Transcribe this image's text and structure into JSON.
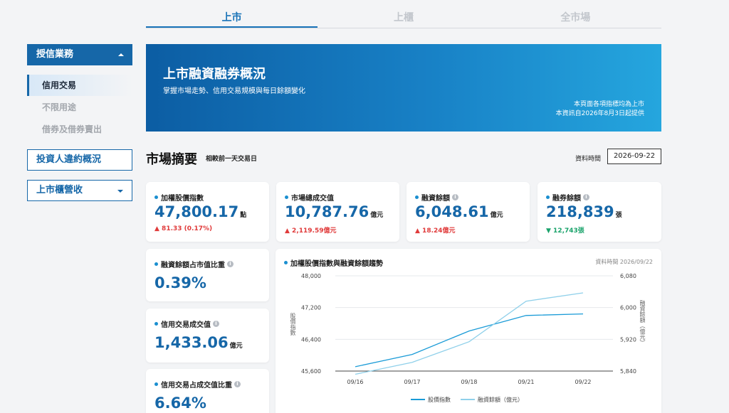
{
  "tabs": [
    "上市",
    "上櫃",
    "全市場"
  ],
  "sidebar": {
    "section_label": "授信業務",
    "items": [
      "信用交易",
      "不限用途",
      "借券及借券賣出"
    ],
    "box1": "投資人違約概況",
    "box2": "上市櫃營收"
  },
  "banner": {
    "title": "上市融資融券概況",
    "subtitle": "掌握市場走勢、信用交易規模與每日餘額變化",
    "note1": "本頁面各項指標均為上市",
    "note2": "本資訊自2026年8月3日起提供"
  },
  "summary": {
    "title": "市場摘要",
    "subtitle": "相較前一天交易日",
    "date_label": "資料時間",
    "date_value": "2026-09-22"
  },
  "cards": [
    {
      "label": "加權股價指數",
      "value": "47,800.17",
      "unit": "點",
      "change": "▲ 81.33 (0.17%)",
      "dir": "up"
    },
    {
      "label": "市場總成交值",
      "value": "10,787.76",
      "unit": "億元",
      "change": "▲ 2,119.59億元",
      "dir": "up"
    },
    {
      "label": "融資餘額",
      "value": "6,048.61",
      "unit": "億元",
      "change": "▲ 18.24億元",
      "dir": "up"
    },
    {
      "label": "融券餘額",
      "value": "218,839",
      "unit": "張",
      "change": "▼ 12,743張",
      "dir": "down"
    }
  ],
  "side_cards": [
    {
      "label": "融資餘額占市值比重",
      "value": "0.39%",
      "unit": ""
    },
    {
      "label": "信用交易成交值",
      "value": "1,433.06",
      "unit": "億元"
    },
    {
      "label": "信用交易占成交值比重",
      "value": "6.64%",
      "unit": ""
    }
  ],
  "info_glyph": "i",
  "chart_data": {
    "type": "line",
    "title": "加權股價指數與融資餘額趨勢",
    "date_note": "資料時間 2026/09/22",
    "categories": [
      "09/16",
      "09/17",
      "09/18",
      "09/21",
      "09/22"
    ],
    "series": [
      {
        "name": "股價指數",
        "axis": "left",
        "color": "#1a9bd7",
        "values": [
          45710,
          46020,
          46610,
          47000,
          47040
        ]
      },
      {
        "name": "融資餘額（億元）",
        "axis": "right",
        "color": "#8fd0ea",
        "values": [
          5832,
          5862,
          5914,
          6016,
          6037
        ]
      }
    ],
    "left_axis": {
      "title": "股價指數",
      "ylim": [
        45600,
        48000
      ],
      "ticks": [
        "48,000",
        "47,200",
        "46,400",
        "45,600"
      ]
    },
    "right_axis": {
      "title": "融資餘額（億元）",
      "ylim": [
        5840,
        6080
      ],
      "ticks": [
        "6,080",
        "6,000",
        "5,920",
        "5,840"
      ]
    },
    "legend_position": "bottom"
  }
}
